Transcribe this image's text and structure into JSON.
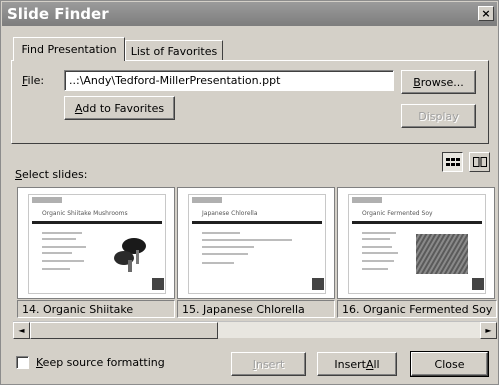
{
  "window": {
    "title": "Slide Finder",
    "close_glyph": "×"
  },
  "tabs": [
    {
      "label": "Find Presentation",
      "active": true
    },
    {
      "label": "List of Favorites",
      "active": false
    }
  ],
  "file": {
    "label_prefix": "F",
    "label_rest": "ile:",
    "value": "..:\\Andy\\Tedford-MillerPresentation.ppt"
  },
  "buttons": {
    "browse_prefix": "B",
    "browse_rest": "rowse...",
    "add_favorites_prefix": "A",
    "add_favorites_rest": "dd to Favorites",
    "display": "Display",
    "insert_prefix": "I",
    "insert_rest": "nsert",
    "insert_all_prefix": "Insert ",
    "insert_all_u": "A",
    "insert_all_rest": "ll",
    "close": "Close"
  },
  "select_slides": {
    "prefix": "S",
    "rest": "elect slides:"
  },
  "view_buttons": [
    {
      "icon": "list-view-icon",
      "pressed": true
    },
    {
      "icon": "thumbnail-view-icon",
      "pressed": false
    }
  ],
  "slides": [
    {
      "thumb_title": "Organic Shiitake Mushrooms",
      "caption": "14. Organic Shiitake",
      "image": "mushroom"
    },
    {
      "thumb_title": "Japanese Chlorella",
      "caption": "15. Japanese Chlorella",
      "image": "none"
    },
    {
      "thumb_title": "Organic Fermented Soy",
      "caption": "16. Organic Fermented Soy",
      "image": "field"
    }
  ],
  "scroll": {
    "left_glyph": "◄",
    "right_glyph": "►"
  },
  "keep_source": {
    "prefix": "K",
    "rest": "eep source formatting",
    "checked": false
  }
}
